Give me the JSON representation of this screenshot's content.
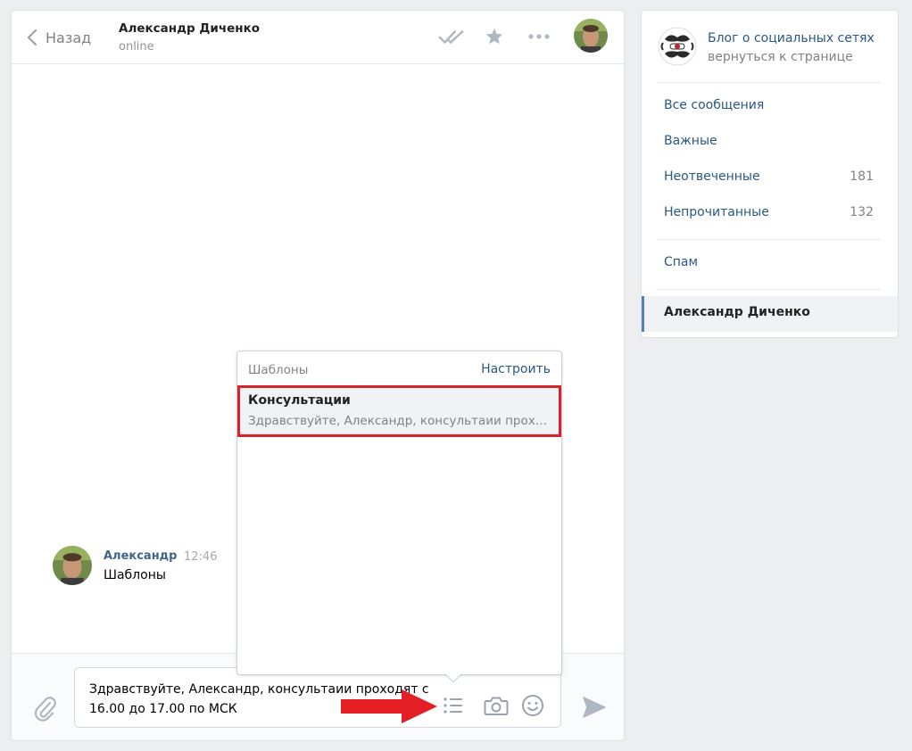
{
  "header": {
    "back_label": "Назад",
    "peer_name": "Александр Диченко",
    "peer_status": "online"
  },
  "message": {
    "author": "Александр",
    "time": "12:46",
    "text": "Шаблоны"
  },
  "templates_popup": {
    "title": "Шаблоны",
    "settings_label": "Настроить",
    "items": [
      {
        "title": "Консультации",
        "preview": "Здравствуйте, Александр, консультаии проходят с 16.00 до 17.00 по МСК"
      }
    ]
  },
  "composer": {
    "text": "Здравствуйте, Александр, консультаии проходят с 16.00 до 17.00 по МСК"
  },
  "sidebar": {
    "community_name": "Блог о социальных сетях",
    "community_back": "вернуться к странице",
    "items": [
      {
        "label": "Все сообщения",
        "count": ""
      },
      {
        "label": "Важные",
        "count": ""
      },
      {
        "label": "Неотвеченные",
        "count": "181"
      },
      {
        "label": "Непрочитанные",
        "count": "132"
      },
      {
        "label": "Спам",
        "count": ""
      },
      {
        "label": "Александр Диченко",
        "count": ""
      }
    ]
  },
  "colors": {
    "link": "#2a5885",
    "author": "#42648b",
    "muted": "#828282",
    "highlight_border": "#d9232a",
    "arrow": "#e31e24",
    "background": "#edeef0"
  },
  "icons": {
    "back": "chevron-left-icon",
    "read": "double-check-icon",
    "favorite": "star-icon",
    "more": "more-dots-icon",
    "attach": "paperclip-icon",
    "templates": "list-icon",
    "photo": "camera-icon",
    "emoji": "smile-icon",
    "send": "send-icon"
  }
}
